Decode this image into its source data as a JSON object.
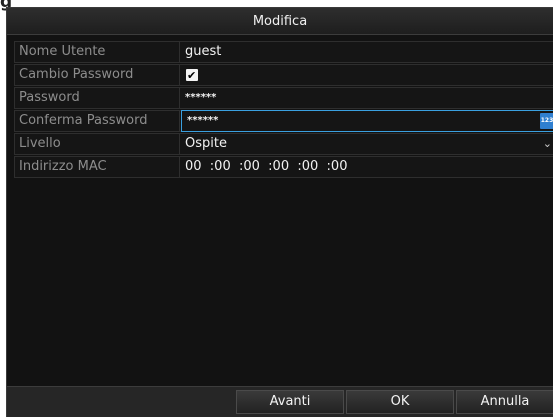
{
  "figure_label": "g",
  "dialog": {
    "title": "Modifica",
    "fields": {
      "username": {
        "label": "Nome Utente",
        "value": "guest"
      },
      "change_password": {
        "label": "Cambio Password",
        "checked": true,
        "check_glyph": "✔"
      },
      "password": {
        "label": "Password",
        "value": "******"
      },
      "confirm_password": {
        "label": "Conferma Password",
        "value": "******",
        "keyboard_icon_text": "123"
      },
      "level": {
        "label": "Livello",
        "value": "Ospite"
      },
      "mac": {
        "label": "Indirizzo MAC",
        "value": "00  :00  :00  :00  :00  :00"
      }
    },
    "buttons": {
      "next": "Avanti",
      "ok": "OK",
      "cancel": "Annulla"
    }
  },
  "colors": {
    "background": "#121212",
    "label_text": "#8d8d8d",
    "value_text": "#f2f2f2",
    "focus_border": "#3aa0e0"
  }
}
